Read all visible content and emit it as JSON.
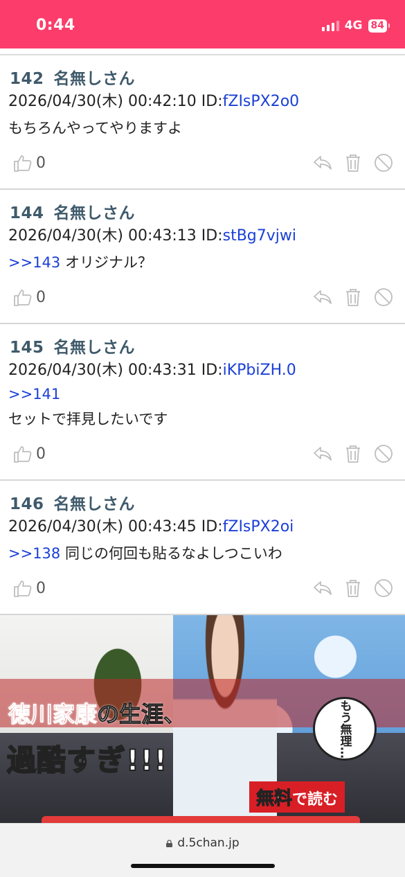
{
  "status": {
    "time": "0:44",
    "network": "4G",
    "battery": "84"
  },
  "posts": [
    {
      "number": "142",
      "name": "名無しさん",
      "date": "2026/04/30(木) 00:42:10",
      "id_label": "ID:",
      "id": "fZIsPX2o0",
      "anchor": "",
      "text": "もちろんやってやりますよ",
      "text2": "",
      "likes": "0"
    },
    {
      "number": "144",
      "name": "名無しさん",
      "date": "2026/04/30(木) 00:43:13",
      "id_label": "ID:",
      "id": "stBg7vjwi",
      "anchor": ">>143",
      "text": "オリジナル？",
      "text2": "",
      "likes": "0"
    },
    {
      "number": "145",
      "name": "名無しさん",
      "date": "2026/04/30(木) 00:43:31",
      "id_label": "ID:",
      "id": "iKPbiZH.0",
      "anchor": ">>141",
      "text": "",
      "text2": "セットで拝見したいです",
      "likes": "0"
    },
    {
      "number": "146",
      "name": "名無しさん",
      "date": "2026/04/30(木) 00:43:45",
      "id_label": "ID:",
      "id": "fZIsPX2oi",
      "anchor": ">>138",
      "text": "同じの何回も貼るなよしつこいわ",
      "text2": "",
      "likes": "0"
    }
  ],
  "ad": {
    "title_red": "徳川家康",
    "title_white": "の生涯、",
    "headline": "過酷すぎ!!!",
    "bubble": "もう無理…",
    "cta_red": "無料",
    "cta_white": "で読む"
  },
  "browser": {
    "url": "d.5chan.jp"
  },
  "icons": {
    "like": "thumbs-up-icon",
    "reply": "reply-icon",
    "delete": "trash-icon",
    "block": "block-icon",
    "lock": "lock-icon"
  },
  "colors": {
    "status_bar": "#fc3d6b",
    "name": "#3f5a6b",
    "link": "#1a3fd6"
  }
}
